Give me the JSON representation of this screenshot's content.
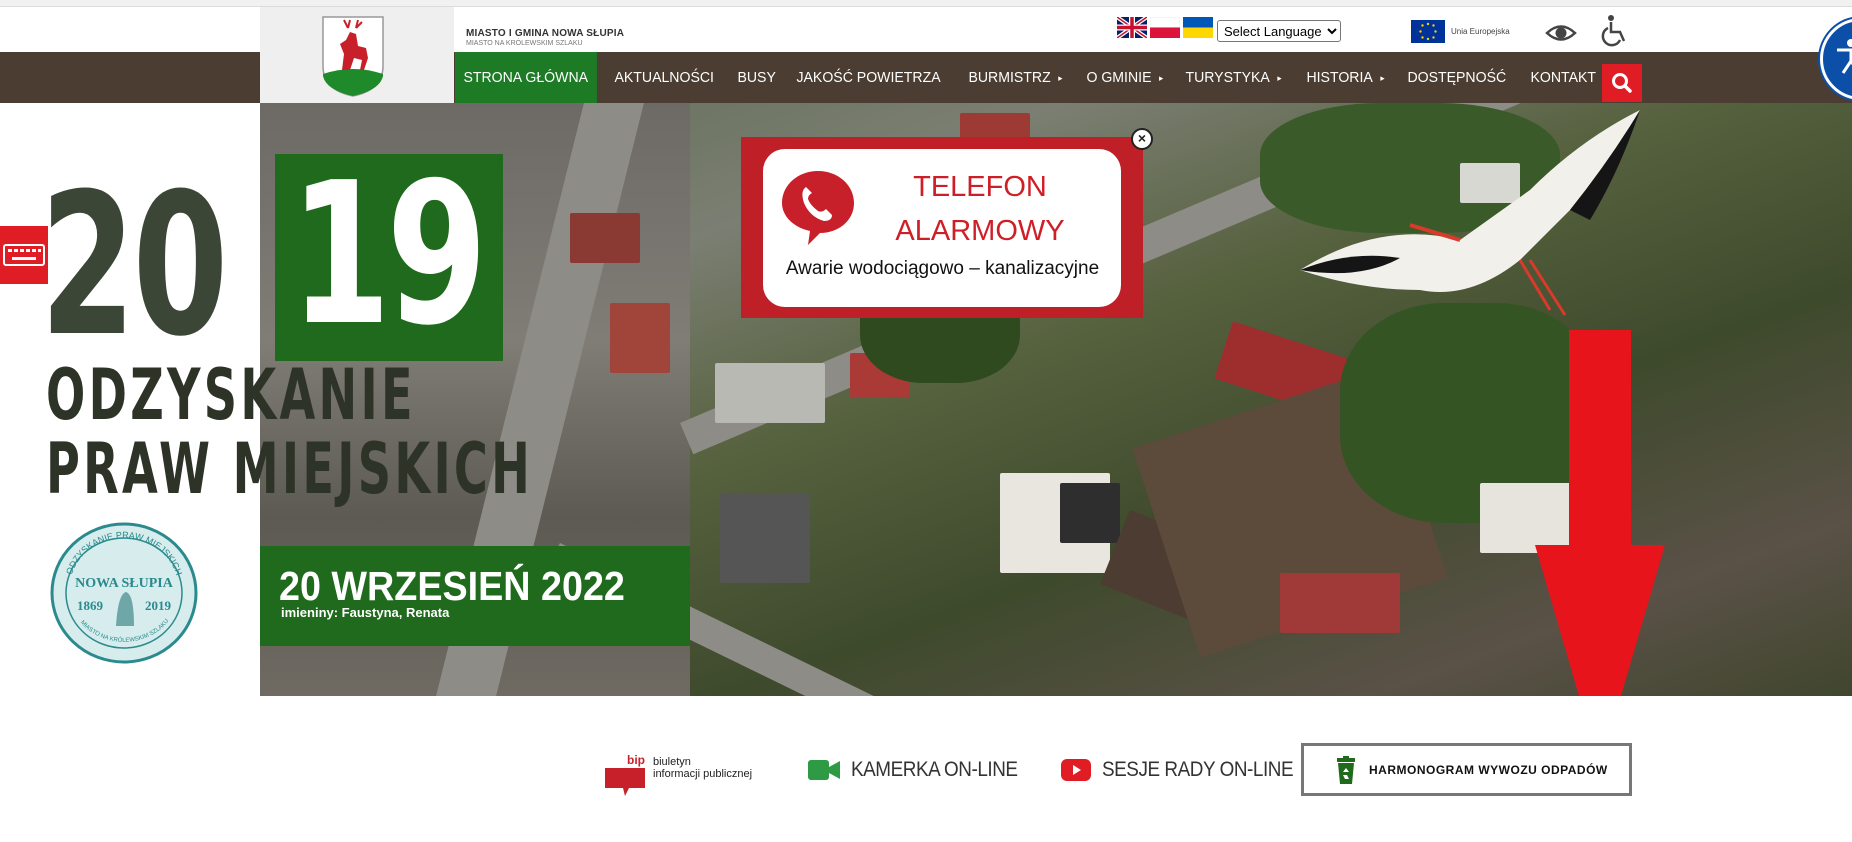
{
  "header": {
    "site_name": "MIASTO I GMINA NOWA SŁUPIA",
    "site_motto": "MIASTO NA KRÓLEWSKIM SZLAKU",
    "language_select": {
      "selected": "Select Language"
    },
    "eu_label": "Unia Europejska"
  },
  "nav": {
    "items": [
      {
        "label": "STRONA GŁÓWNA",
        "active": true
      },
      {
        "label": "AKTUALNOŚCI"
      },
      {
        "label": "BUSY"
      },
      {
        "label": "JAKOŚĆ POWIETRZA"
      },
      {
        "label": "BURMISTRZ",
        "caret": "▸"
      },
      {
        "label": "O GMINIE",
        "caret": "▸"
      },
      {
        "label": "TURYSTYKA",
        "caret": "▸"
      },
      {
        "label": "HISTORIA",
        "caret": "▸"
      },
      {
        "label": "DOSTĘPNOŚĆ"
      },
      {
        "label": "KONTAKT"
      }
    ]
  },
  "hero": {
    "year_part1": "20",
    "year_part2": "19",
    "tagline_line1": "ODZYSKANIE",
    "tagline_line2": "PRAW MIEJSKICH",
    "medal": {
      "ring_text": "ODZYSKANIE PRAW MIEJSKICH",
      "name": "NOWA SŁUPIA",
      "year_from": "1869",
      "year_to": "2019",
      "bottom_text": "MIASTO NA KRÓLEWSKIM SZLAKU"
    },
    "date": "20 WRZESIEŃ 2022",
    "nameday": "imieniny: Faustyna, Renata"
  },
  "popup": {
    "title_line1": "TELEFON",
    "title_line2": "ALARMOWY",
    "subtitle": "Awarie wodociągowo – kanalizacyjne",
    "close": "×"
  },
  "footer_links": {
    "bip_badge": "bip",
    "bip_line1": "biuletyn",
    "bip_line2": "informacji publicznej",
    "kamerka": "KAMERKA ON-LINE",
    "sesje": "SESJE RADY ON-LINE",
    "harmonogram": "HARMONOGRAM WYWOZU ODPADÓW"
  },
  "colors": {
    "nav_bg": "#4b3d31",
    "active_green": "#1d7a25",
    "accent_red": "#e01c24",
    "popup_red": "#bf2027"
  }
}
